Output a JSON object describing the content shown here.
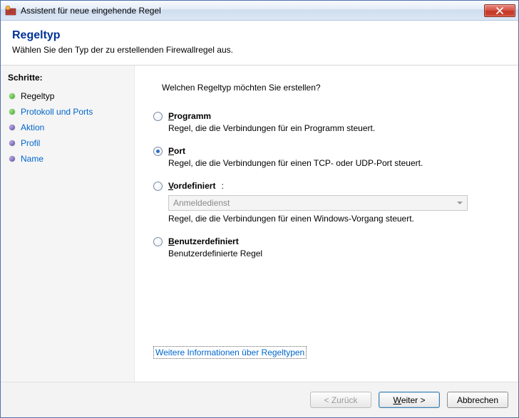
{
  "window": {
    "title": "Assistent für neue eingehende Regel"
  },
  "header": {
    "heading": "Regeltyp",
    "subheading": "Wählen Sie den Typ der zu erstellenden Firewallregel aus."
  },
  "sidebar": {
    "title": "Schritte:",
    "steps": [
      {
        "label": "Regeltyp",
        "state": "current",
        "bullet": "green"
      },
      {
        "label": "Protokoll und Ports",
        "state": "link",
        "bullet": "green"
      },
      {
        "label": "Aktion",
        "state": "link",
        "bullet": "purple"
      },
      {
        "label": "Profil",
        "state": "link",
        "bullet": "purple"
      },
      {
        "label": "Name",
        "state": "link",
        "bullet": "purple"
      }
    ]
  },
  "main": {
    "question": "Welchen Regeltyp möchten Sie erstellen?",
    "options": {
      "program": {
        "title": "Programm",
        "desc": "Regel, die die Verbindungen für ein Programm steuert.",
        "selected": false
      },
      "port": {
        "title": "Port",
        "desc": "Regel, die die Verbindungen für einen TCP- oder UDP-Port steuert.",
        "selected": true
      },
      "predefined": {
        "title": "Vordefiniert",
        "title_suffix": ":",
        "combo_value": "Anmeldedienst",
        "desc": "Regel, die die Verbindungen für einen Windows-Vorgang steuert.",
        "selected": false,
        "combo_enabled": false
      },
      "custom": {
        "title": "Benutzerdefiniert",
        "desc": "Benutzerdefinierte Regel",
        "selected": false
      }
    },
    "more_link": "Weitere Informationen über Regeltypen"
  },
  "footer": {
    "back": "< Zurück",
    "next": "Weiter >",
    "cancel": "Abbrechen",
    "back_enabled": false
  }
}
